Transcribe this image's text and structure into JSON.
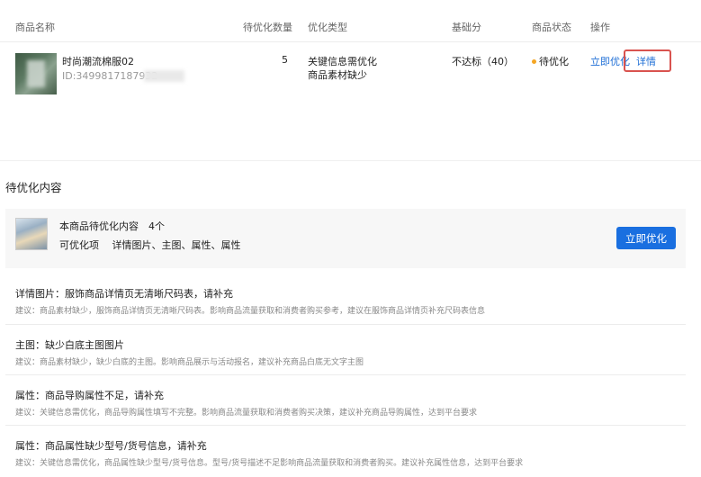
{
  "table": {
    "headers": {
      "name": "商品名称",
      "count": "待优化数量",
      "type": "优化类型",
      "score": "基础分",
      "status": "商品状态",
      "action": "操作"
    },
    "row": {
      "product_name": "时尚潮流棉服02",
      "product_id": "ID:3499817187932",
      "count": "5",
      "type_line1": "关键信息需优化",
      "type_line2": "商品素材缺少",
      "score": "不达标（40）",
      "status": "待优化",
      "action_optimize": "立即优化",
      "action_detail": "详情"
    }
  },
  "section": {
    "title": "待优化内容",
    "summary_line1": "本商品待优化内容　4个",
    "summary_line2": "可优化项　 详情图片、主图、属性、属性",
    "optimize_button": "立即优化"
  },
  "items": [
    {
      "title": "详情图片：服饰商品详情页无清晰尺码表，请补充",
      "desc": "建议：商品素材缺少，服饰商品详情页无清晰尺码表。影响商品流量获取和消费者购买参考，建议在服饰商品详情页补充尺码表信息"
    },
    {
      "title": "主图：缺少白底主图图片",
      "desc": "建议：商品素材缺少，缺少白底的主图。影响商品展示与活动报名，建议补充商品白底无文字主图"
    },
    {
      "title": "属性：商品导购属性不足，请补充",
      "desc": "建议：关键信息需优化，商品导购属性填写不完整。影响商品流量获取和消费者购买决策，建议补充商品导购属性，达到平台要求"
    },
    {
      "title": "属性：商品属性缺少型号/货号信息，请补充",
      "desc": "建议：关键信息需优化，商品属性缺少型号/货号信息。型号/货号描述不足影响商品流量获取和消费者购买。建议补充属性信息，达到平台要求"
    }
  ],
  "colors": {
    "accent": "#1a6fe0",
    "status_dot": "#f5a623",
    "highlight_box": "#d9534f"
  }
}
